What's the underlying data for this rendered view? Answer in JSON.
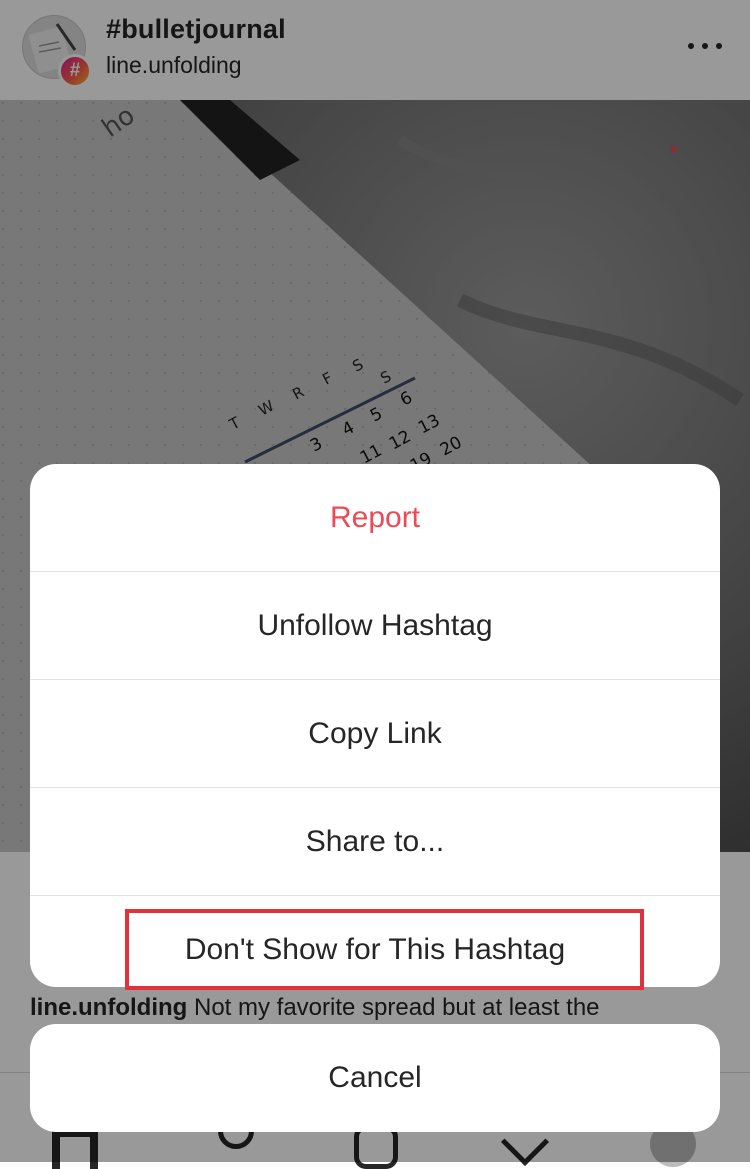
{
  "header": {
    "hashtag": "#bulletjournal",
    "username": "line.unfolding",
    "hash_badge": "#",
    "avatar_icon": "notebook-avatar-icon",
    "more_icon": "more-options-icon"
  },
  "post": {
    "calendar_weekdays": [
      "T",
      "W",
      "R",
      "F",
      "S",
      "S"
    ],
    "calendar_row1": [
      "3",
      "4",
      "5",
      "6"
    ],
    "calendar_row2": [
      "11",
      "12",
      "13"
    ],
    "calendar_row3": [
      "19",
      "20"
    ],
    "caption_username": "line.unfolding",
    "caption_text": "Not my favorite spread but at least the"
  },
  "action_sheet": {
    "items": [
      {
        "label": "Report",
        "style": "destructive",
        "color": "#ed4956"
      },
      {
        "label": "Unfollow Hashtag",
        "style": "default"
      },
      {
        "label": "Copy Link",
        "style": "default"
      },
      {
        "label": "Share to...",
        "style": "default"
      },
      {
        "label": "Don't Show for This Hashtag",
        "style": "default",
        "highlighted": true
      }
    ],
    "cancel_label": "Cancel"
  },
  "tabbar": {
    "icons": [
      "home-icon",
      "search-icon",
      "add-post-icon",
      "activity-heart-icon",
      "profile-avatar-icon"
    ],
    "notification_dot_color": "#ed4956"
  },
  "colors": {
    "destructive": "#ed4956",
    "highlight_box": "#e0323c",
    "text": "#262626"
  }
}
